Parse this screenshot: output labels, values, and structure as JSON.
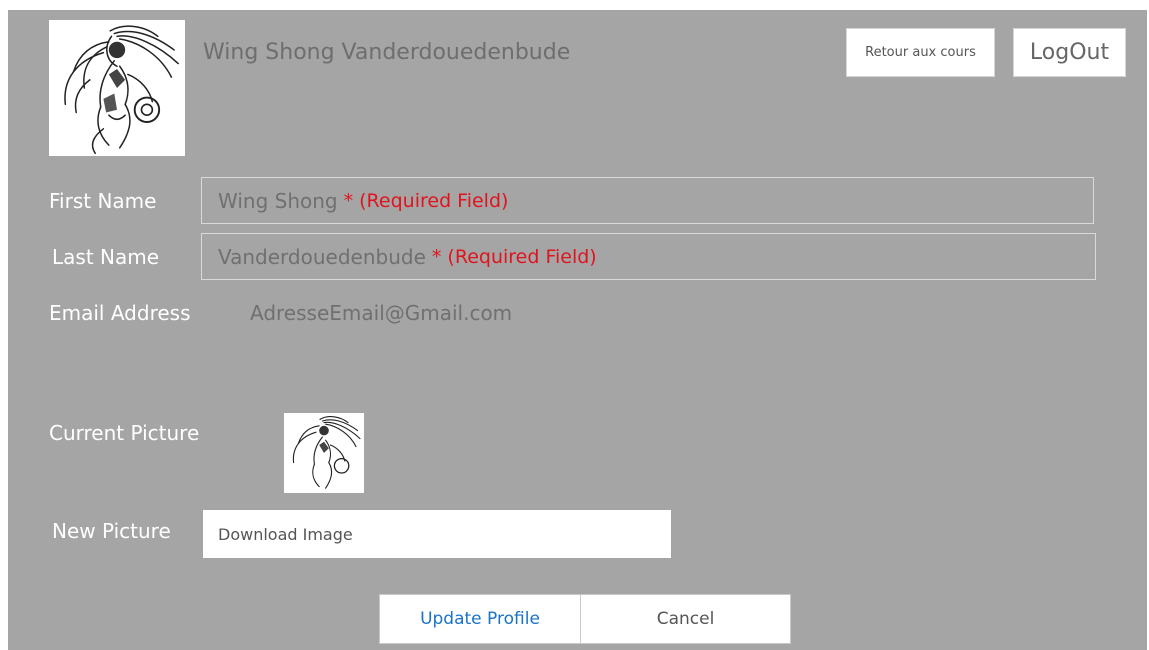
{
  "header": {
    "user_name": "Wing Shong Vanderdouedenbude",
    "back_button_label": "Retour aux cours",
    "logout_button_label": "LogOut"
  },
  "form": {
    "first_name": {
      "label": "First Name",
      "value": "Wing Shong",
      "required_note": "* (Required Field)"
    },
    "last_name": {
      "label": "Last Name",
      "value": "Vanderdouedenbude",
      "required_note": "* (Required Field)"
    },
    "email": {
      "label": "Email Address",
      "value": "AdresseEmail@Gmail.com"
    },
    "current_picture": {
      "label": "Current Picture"
    },
    "new_picture": {
      "label": "New Picture",
      "button_text": "Download Image"
    }
  },
  "actions": {
    "update_label": "Update Profile",
    "cancel_label": "Cancel"
  },
  "colors": {
    "panel_background": "#a5a5a5",
    "required_text": "#e0141e",
    "update_link": "#1a73c8"
  }
}
